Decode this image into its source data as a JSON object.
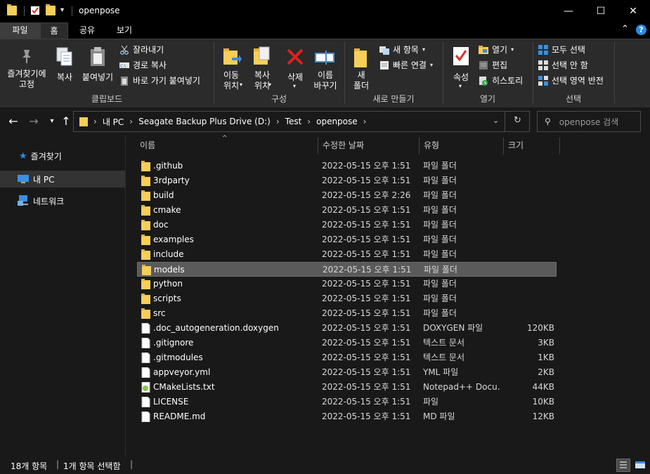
{
  "window": {
    "title": "openpose",
    "minimize": "—",
    "maximize": "☐",
    "close": "✕"
  },
  "tabs": {
    "file": "파일",
    "home": "홈",
    "share": "공유",
    "view": "보기"
  },
  "ribbon": {
    "clipboard": {
      "pin": "즐겨찾기에\n고정",
      "copy": "복사",
      "paste": "붙여넣기",
      "cut": "잘라내기",
      "copy_path": "경로 복사",
      "paste_shortcut": "바로 가기 붙여넣기",
      "label": "클립보드"
    },
    "organize": {
      "move_to": "이동\n위치",
      "copy_to": "복사\n위치",
      "delete": "삭제",
      "rename": "이름\n바꾸기",
      "label": "구성"
    },
    "new": {
      "new_folder": "새\n폴더",
      "new_item": "새 항목",
      "easy_access": "빠른 연결",
      "label": "새로 만들기"
    },
    "open": {
      "properties": "속성",
      "open": "열기",
      "edit": "편집",
      "history": "히스토리",
      "label": "열기"
    },
    "select": {
      "select_all": "모두 선택",
      "select_none": "선택 안 함",
      "invert": "선택 영역 반전",
      "label": "선택"
    }
  },
  "address": {
    "crumbs": [
      "내 PC",
      "Seagate Backup Plus Drive (D:)",
      "Test",
      "openpose"
    ],
    "search_placeholder": "openpose 검색"
  },
  "nav": {
    "quick_access": "즐겨찾기",
    "this_pc": "내 PC",
    "network": "네트워크"
  },
  "columns": {
    "name": "이름",
    "date": "수정한 날짜",
    "type": "유형",
    "size": "크기"
  },
  "files": [
    {
      "name": ".github",
      "date": "2022-05-15 오후 1:51",
      "type": "파일 폴더",
      "size": "",
      "kind": "folder"
    },
    {
      "name": "3rdparty",
      "date": "2022-05-15 오후 1:51",
      "type": "파일 폴더",
      "size": "",
      "kind": "folder"
    },
    {
      "name": "build",
      "date": "2022-05-15 오후 2:26",
      "type": "파일 폴더",
      "size": "",
      "kind": "folder"
    },
    {
      "name": "cmake",
      "date": "2022-05-15 오후 1:51",
      "type": "파일 폴더",
      "size": "",
      "kind": "folder"
    },
    {
      "name": "doc",
      "date": "2022-05-15 오후 1:51",
      "type": "파일 폴더",
      "size": "",
      "kind": "folder"
    },
    {
      "name": "examples",
      "date": "2022-05-15 오후 1:51",
      "type": "파일 폴더",
      "size": "",
      "kind": "folder"
    },
    {
      "name": "include",
      "date": "2022-05-15 오후 1:51",
      "type": "파일 폴더",
      "size": "",
      "kind": "folder"
    },
    {
      "name": "models",
      "date": "2022-05-15 오후 1:51",
      "type": "파일 폴더",
      "size": "",
      "kind": "folder",
      "selected": true
    },
    {
      "name": "python",
      "date": "2022-05-15 오후 1:51",
      "type": "파일 폴더",
      "size": "",
      "kind": "folder"
    },
    {
      "name": "scripts",
      "date": "2022-05-15 오후 1:51",
      "type": "파일 폴더",
      "size": "",
      "kind": "folder"
    },
    {
      "name": "src",
      "date": "2022-05-15 오후 1:51",
      "type": "파일 폴더",
      "size": "",
      "kind": "folder"
    },
    {
      "name": ".doc_autogeneration.doxygen",
      "date": "2022-05-15 오후 1:51",
      "type": "DOXYGEN 파일",
      "size": "120KB",
      "kind": "file"
    },
    {
      "name": ".gitignore",
      "date": "2022-05-15 오후 1:51",
      "type": "텍스트 문서",
      "size": "3KB",
      "kind": "file"
    },
    {
      "name": ".gitmodules",
      "date": "2022-05-15 오후 1:51",
      "type": "텍스트 문서",
      "size": "1KB",
      "kind": "file"
    },
    {
      "name": "appveyor.yml",
      "date": "2022-05-15 오후 1:51",
      "type": "YML 파일",
      "size": "2KB",
      "kind": "file"
    },
    {
      "name": "CMakeLists.txt",
      "date": "2022-05-15 오후 1:51",
      "type": "Notepad++ Docu...",
      "size": "44KB",
      "kind": "npp"
    },
    {
      "name": "LICENSE",
      "date": "2022-05-15 오후 1:51",
      "type": "파일",
      "size": "10KB",
      "kind": "file"
    },
    {
      "name": "README.md",
      "date": "2022-05-15 오후 1:51",
      "type": "MD 파일",
      "size": "12KB",
      "kind": "file"
    }
  ],
  "status": {
    "count": "18개 항목",
    "selected": "1개 항목 선택함"
  },
  "colors": {
    "folder": "#f7ce5a",
    "accent": "#2b8ce6",
    "selection": "#5a5a5a"
  }
}
